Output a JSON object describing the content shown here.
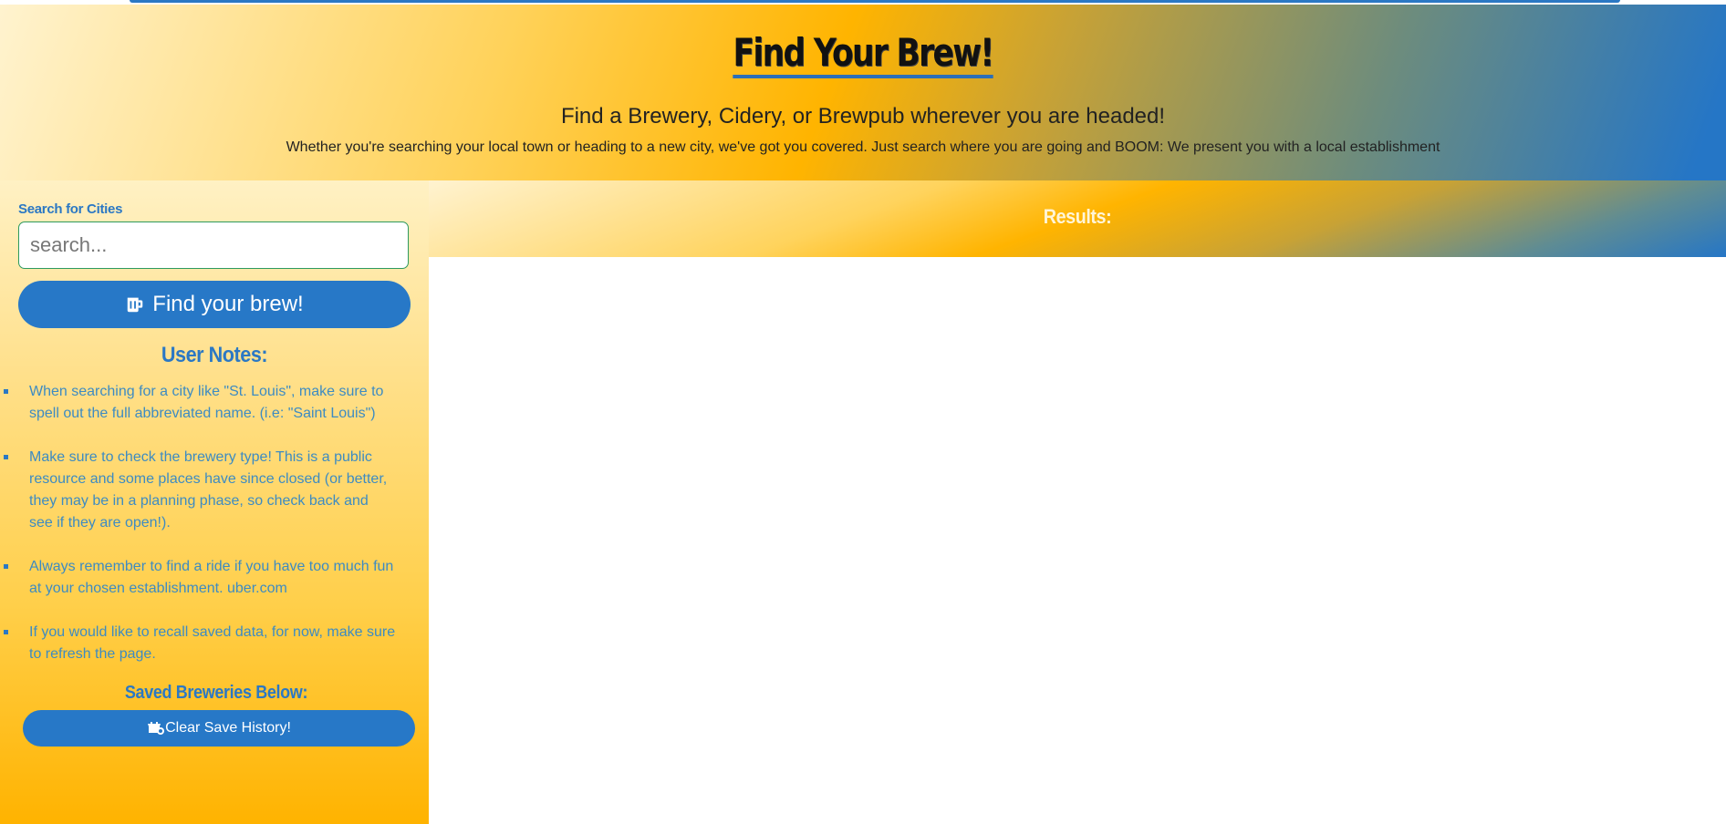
{
  "header": {
    "title": "Find Your Brew!",
    "tagline": "Find a Brewery, Cidery, or Brewpub wherever you are headed!",
    "description": "Whether you're searching your local town or heading to a new city, we've got you covered. Just search where you are going and BOOM: We present you with a local establishment"
  },
  "search": {
    "label": "Search for Cities",
    "placeholder": "search...",
    "value": "",
    "button_label": "Find your brew!",
    "button_icon": "beer-mug-icon"
  },
  "notes": {
    "title": "User Notes:",
    "items": [
      {
        "text": "When searching for a city like \"St. Louis\", make sure to spell out the full abbreviated name. (i.e: \"Saint Louis\")"
      },
      {
        "text": "Make sure to check the brewery type! This is a public resource and some places have since closed (or better, they may be in a planning phase, so check back and see if they are open!)."
      },
      {
        "text": "Always remember to find a ride if you have too much fun at your chosen establishment. uber.com"
      },
      {
        "text": "If you would like to recall saved data, for now, make sure to refresh the page."
      }
    ]
  },
  "saved": {
    "title": "Saved Breweries Below:",
    "clear_button_label": "Clear Save History!",
    "clear_button_icon": "dumpster-fire-icon"
  },
  "results": {
    "label": "Results:"
  },
  "colors": {
    "accent_blue": "#2778c7",
    "brand_yellow": "#ffb400",
    "input_border": "#2d9a5f"
  }
}
